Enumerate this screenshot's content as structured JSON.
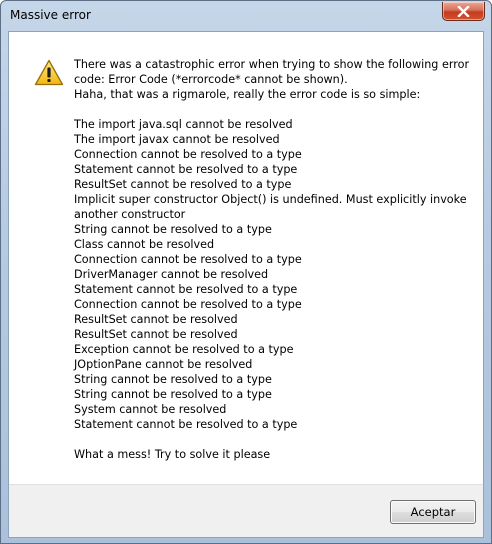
{
  "window": {
    "title": "Massive error",
    "close_icon": "close-icon"
  },
  "dialog": {
    "icon": "warning-icon",
    "message_lines": [
      "There was a catastrophic error when trying to show the following error",
      "code: Error Code (*errorcode* cannot be shown).",
      "Haha, that was a rigmarole, really the error code is so simple:",
      "",
      "The import java.sql cannot be resolved",
      "The import javax cannot be resolved",
      "Connection cannot be resolved to a type",
      "Statement cannot be resolved to a type",
      "ResultSet cannot be resolved to a type",
      "Implicit super constructor Object() is undefined. Must explicitly invoke",
      "another constructor",
      "String cannot be resolved to a type",
      "Class cannot be resolved",
      "Connection cannot be resolved to a type",
      "DriverManager cannot be resolved",
      "Statement cannot be resolved to a type",
      "Connection cannot be resolved to a type",
      "ResultSet cannot be resolved",
      "ResultSet cannot be resolved",
      "Exception cannot be resolved to a type",
      "JOptionPane cannot be resolved",
      "String cannot be resolved to a type",
      "String cannot be resolved to a type",
      "System cannot be resolved",
      "Statement cannot be resolved to a type",
      "",
      "What a mess! Try to solve it please"
    ],
    "accept_label": "Aceptar"
  },
  "colors": {
    "close_button": "#c74a30",
    "frame": "#b9cce3",
    "footer": "#f0f0f0",
    "warning_fill": "#f5c21b"
  }
}
